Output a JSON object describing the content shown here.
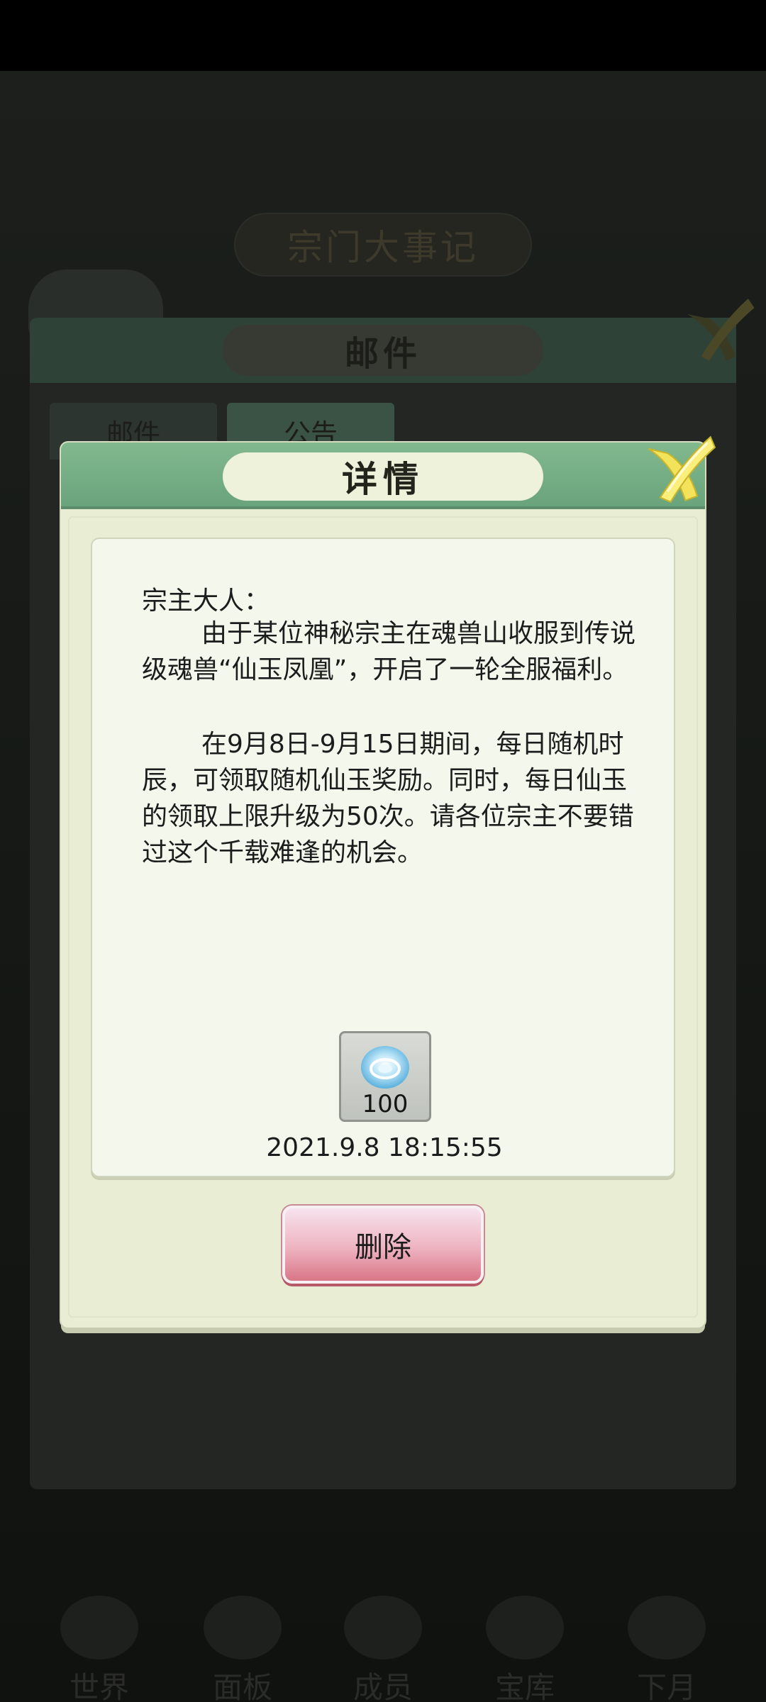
{
  "background": {
    "banner_title": "宗门大事记",
    "panel_title": "邮件",
    "tabs": [
      "邮件",
      "公告"
    ],
    "nav": [
      "世界",
      "面板",
      "成员",
      "宝库",
      "下月"
    ]
  },
  "dialog": {
    "title": "详情",
    "mail": {
      "greeting": "宗主大人：",
      "paragraphs": [
        "由于某位神秘宗主在魂兽山收服到传说级魂兽“仙玉凤凰”，开启了一轮全服福利。",
        "在9月8日-9月15日期间，每日随机时辰，可领取随机仙玉奖励。同时，每日仙玉的领取上限升级为50次。请各位宗主不要错过这个千载难逢的机会。"
      ],
      "reward": {
        "icon": "jade-orb-icon",
        "count": "100"
      },
      "timestamp": "2021.9.8   18:15:55"
    },
    "delete_label": "删除"
  },
  "colors": {
    "dialog_header": "#6aa47c",
    "dialog_bg": "#e9edd4",
    "card_bg": "#f4f8ec",
    "delete_button": "#eeb3c0",
    "close_icon": "#f3e35a"
  }
}
